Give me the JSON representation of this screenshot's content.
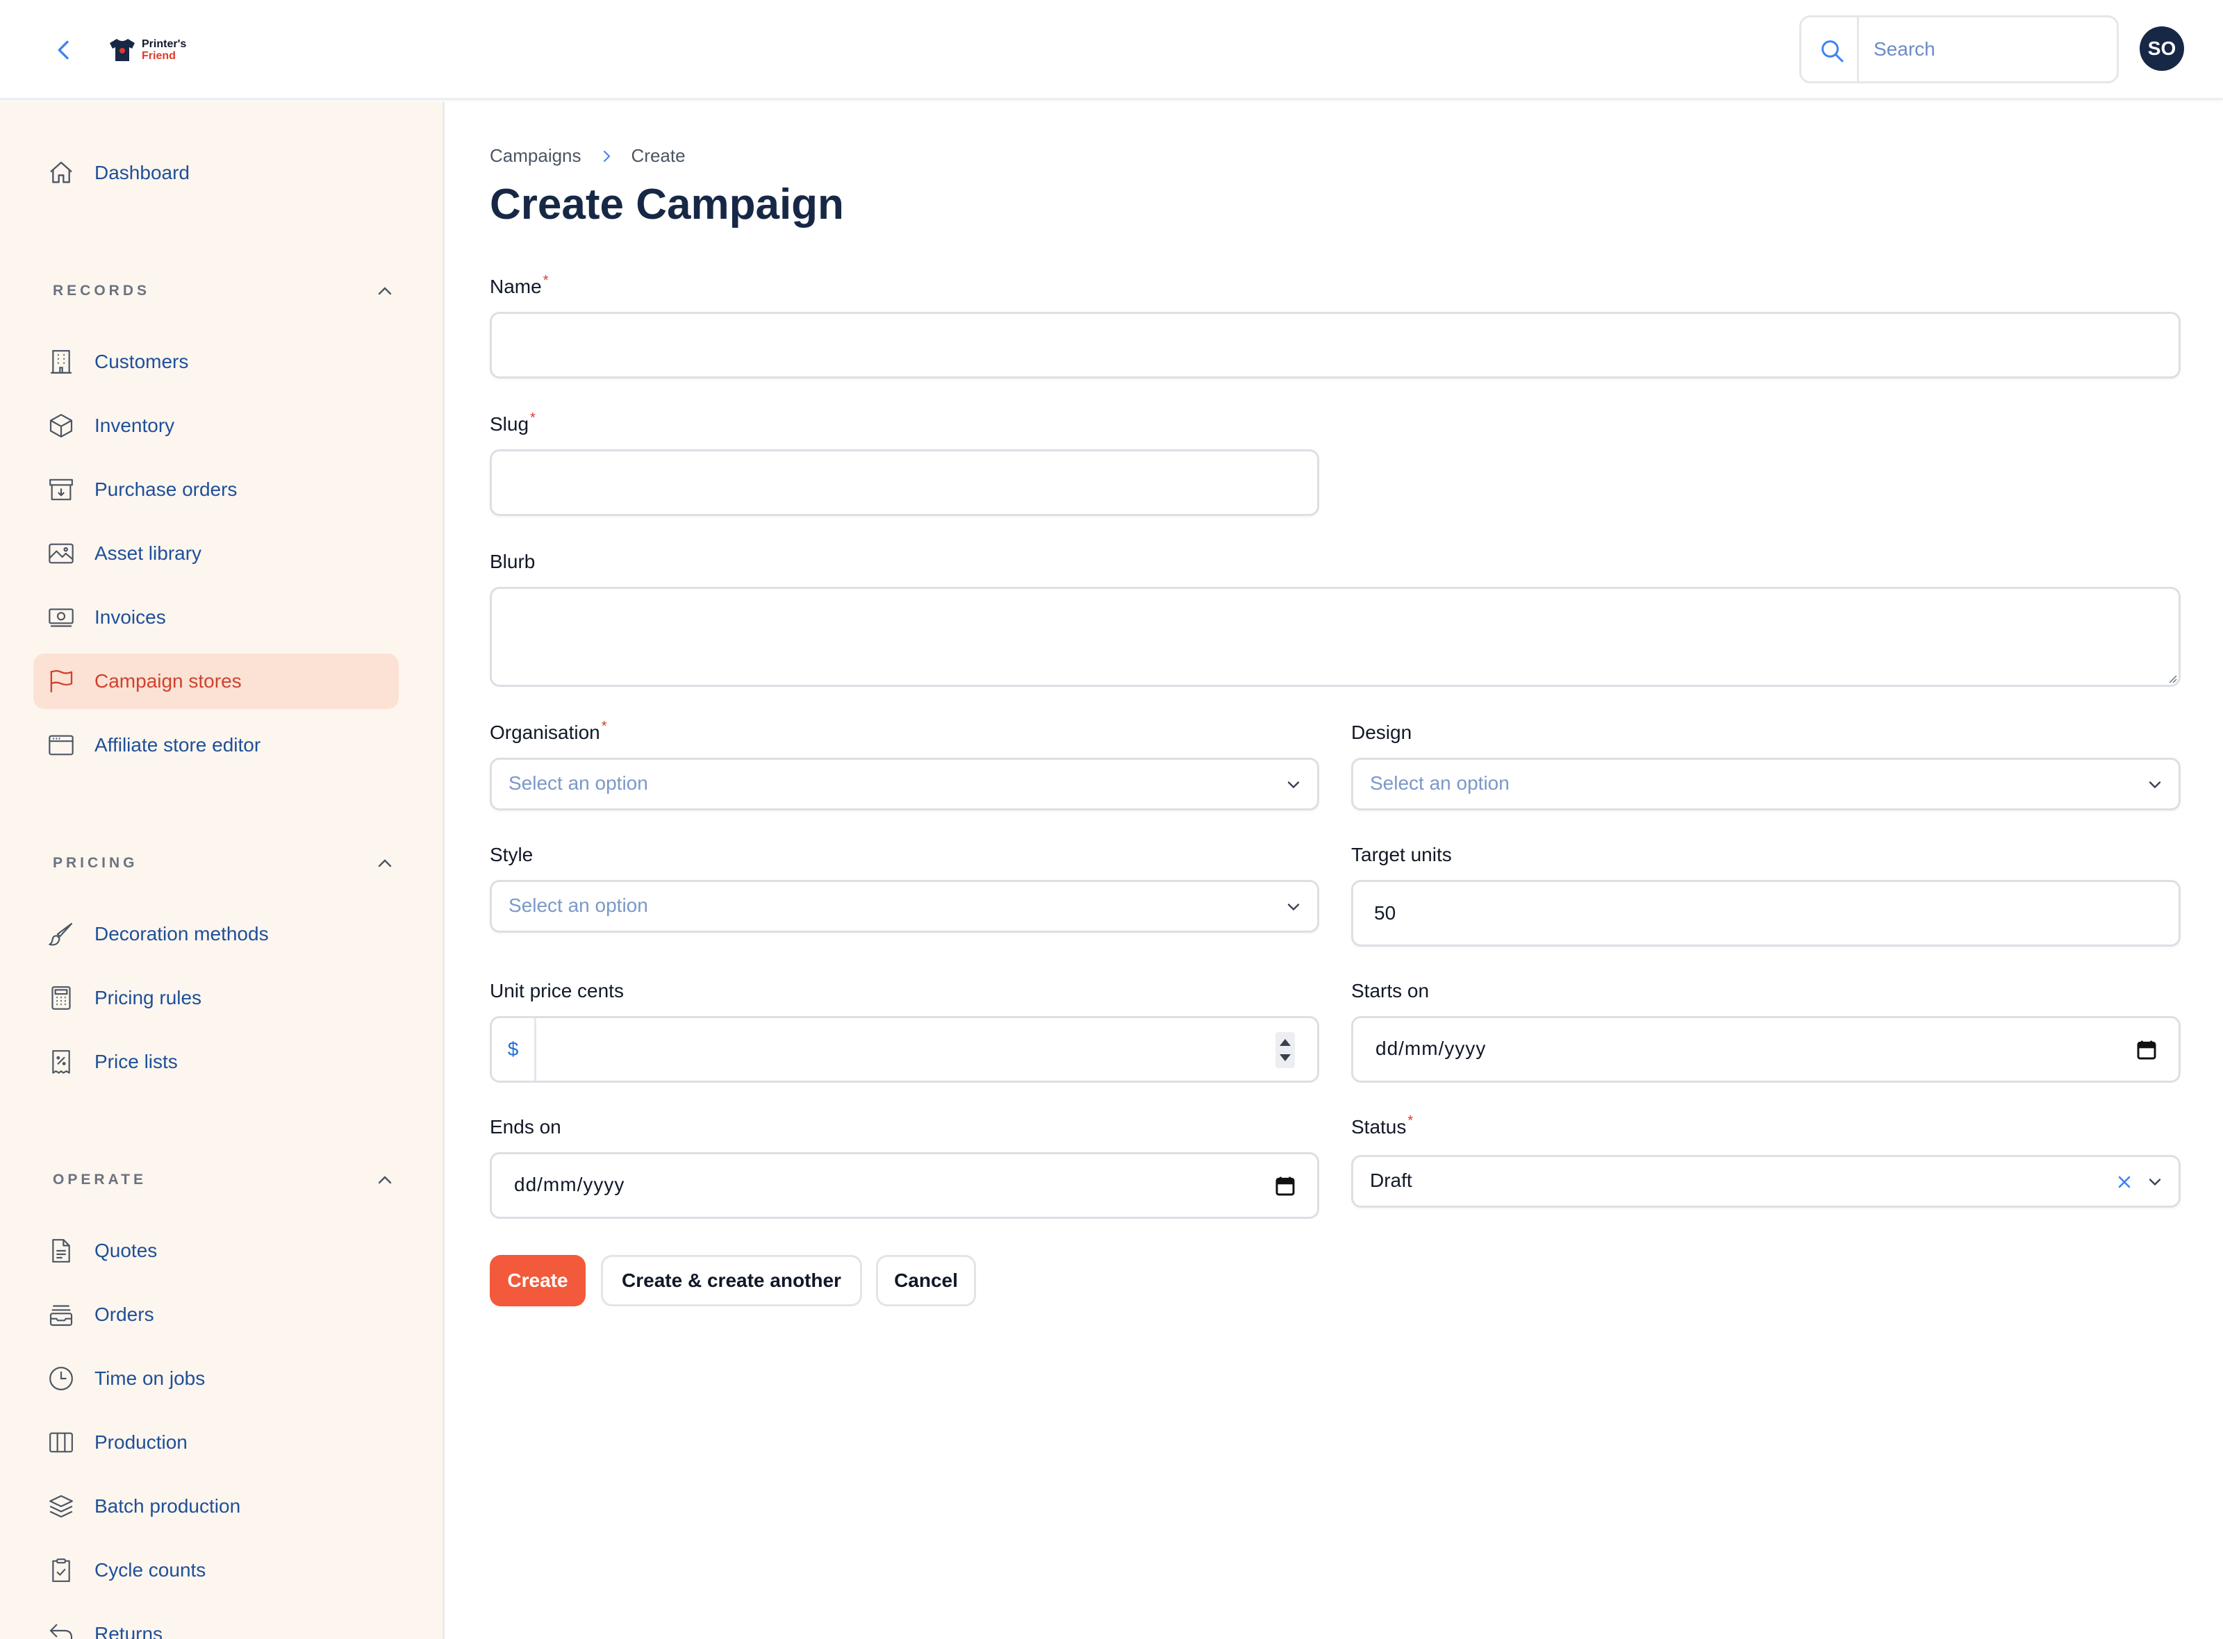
{
  "app": {
    "logo_line1": "Printer's",
    "logo_line2": "Friend",
    "brand_color": "#f25a3b",
    "accent_color": "#1f4f99"
  },
  "topbar": {
    "search_placeholder": "Search",
    "search_value": "",
    "user_initials": "SO"
  },
  "sidebar": {
    "dashboard": {
      "label": "Dashboard",
      "icon": "home-icon"
    },
    "sections": [
      {
        "label": "RECORDS",
        "expanded": true,
        "items": [
          {
            "label": "Customers",
            "icon": "building-icon"
          },
          {
            "label": "Inventory",
            "icon": "cube-icon"
          },
          {
            "label": "Purchase orders",
            "icon": "archive-box-icon"
          },
          {
            "label": "Asset library",
            "icon": "photo-icon"
          },
          {
            "label": "Invoices",
            "icon": "banknotes-icon"
          },
          {
            "label": "Campaign stores",
            "icon": "flag-icon",
            "active": true
          },
          {
            "label": "Affiliate store editor",
            "icon": "window-icon"
          }
        ]
      },
      {
        "label": "PRICING",
        "expanded": true,
        "items": [
          {
            "label": "Decoration methods",
            "icon": "paint-brush-icon"
          },
          {
            "label": "Pricing rules",
            "icon": "calculator-icon"
          },
          {
            "label": "Price lists",
            "icon": "receipt-percent-icon"
          }
        ]
      },
      {
        "label": "OPERATE",
        "expanded": true,
        "items": [
          {
            "label": "Quotes",
            "icon": "document-text-icon"
          },
          {
            "label": "Orders",
            "icon": "inbox-stack-icon"
          },
          {
            "label": "Time on jobs",
            "icon": "clock-icon"
          },
          {
            "label": "Production",
            "icon": "view-columns-icon"
          },
          {
            "label": "Batch production",
            "icon": "square-stack-icon"
          },
          {
            "label": "Cycle counts",
            "icon": "clipboard-check-icon"
          },
          {
            "label": "Returns",
            "icon": "arrow-uturn-left-icon"
          }
        ]
      }
    ]
  },
  "breadcrumb": {
    "parent": "Campaigns",
    "current": "Create"
  },
  "page": {
    "title": "Create Campaign"
  },
  "form": {
    "name": {
      "label": "Name",
      "required": true,
      "value": ""
    },
    "slug": {
      "label": "Slug",
      "required": true,
      "value": ""
    },
    "blurb": {
      "label": "Blurb",
      "value": ""
    },
    "organisation": {
      "label": "Organisation",
      "required": true,
      "placeholder": "Select an option"
    },
    "design": {
      "label": "Design",
      "placeholder": "Select an option"
    },
    "style": {
      "label": "Style",
      "placeholder": "Select an option"
    },
    "target_units": {
      "label": "Target units",
      "value": "50"
    },
    "unit_price_cents": {
      "label": "Unit price cents",
      "prefix": "$",
      "value": ""
    },
    "starts_on": {
      "label": "Starts on",
      "placeholder": "dd/mm/yyyy"
    },
    "ends_on": {
      "label": "Ends on",
      "placeholder": "dd/mm/yyyy"
    },
    "status": {
      "label": "Status",
      "required": true,
      "value": "Draft"
    }
  },
  "actions": {
    "create": "Create",
    "create_another": "Create & create another",
    "cancel": "Cancel"
  }
}
